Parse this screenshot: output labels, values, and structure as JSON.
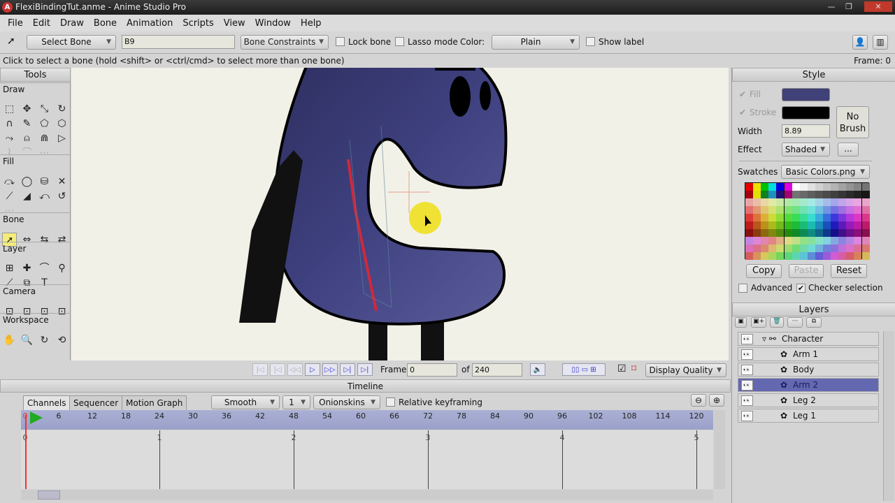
{
  "window": {
    "title": "FlexiBindingTut.anme - Anime Studio Pro",
    "logo": "A",
    "controls": [
      "—",
      "❐",
      "✕"
    ]
  },
  "menu": [
    "File",
    "Edit",
    "Draw",
    "Bone",
    "Animation",
    "Scripts",
    "View",
    "Window",
    "Help"
  ],
  "toolbar": {
    "tool_select": "Select Bone",
    "bone_name": "B9",
    "constraints": "Bone Constraints",
    "lock_bone": "Lock bone",
    "lock_bone_checked": false,
    "lasso_mode": "Lasso mode",
    "lasso_checked": false,
    "color_label": "Color:",
    "color_value": "Plain",
    "show_label": "Show label",
    "show_label_checked": false
  },
  "status": {
    "hint": "Click to select a bone (hold <shift> or <ctrl/cmd> to select more than one bone)",
    "frame": "Frame: 0"
  },
  "tools": {
    "title": "Tools",
    "sections": {
      "draw": "Draw",
      "fill": "Fill",
      "bone": "Bone",
      "layer": "Layer",
      "camera": "Camera",
      "workspace": "Workspace"
    }
  },
  "style": {
    "title": "Style",
    "fill_label": "Fill",
    "fill_color": "#3f4178",
    "stroke_label": "Stroke",
    "stroke_color": "#000000",
    "width_label": "Width",
    "width_value": "8.89",
    "no_brush": "No Brush",
    "effect_label": "Effect",
    "effect_value": "Shaded",
    "more": "...",
    "swatches_label": "Swatches",
    "swatches_value": "Basic Colors.png",
    "copy": "Copy",
    "paste": "Paste",
    "reset": "Reset",
    "advanced": "Advanced",
    "advanced_checked": false,
    "checker": "Checker selection",
    "checker_checked": true
  },
  "layers": {
    "title": "Layers",
    "items": [
      {
        "name": "Character",
        "type": "bone-group"
      },
      {
        "name": "Arm 1",
        "type": "vector"
      },
      {
        "name": "Body",
        "type": "vector"
      },
      {
        "name": "Arm 2",
        "type": "vector",
        "selected": true
      },
      {
        "name": "Leg 2",
        "type": "vector"
      },
      {
        "name": "Leg 1",
        "type": "vector"
      }
    ]
  },
  "playback": {
    "frame_label": "Frame",
    "frame_value": "0",
    "of_label": "of",
    "total": "240",
    "display_quality": "Display Quality"
  },
  "timeline": {
    "title": "Timeline",
    "tabs": [
      "Channels",
      "Sequencer",
      "Motion Graph"
    ],
    "interp": "Smooth",
    "interp_num": "1",
    "onionskins": "Onionskins",
    "relative": "Relative keyframing",
    "relative_checked": false,
    "ruler": [
      "0",
      "6",
      "12",
      "18",
      "24",
      "30",
      "36",
      "42",
      "48",
      "54",
      "60",
      "66",
      "72",
      "78",
      "84",
      "90",
      "96",
      "102",
      "108",
      "114",
      "120"
    ],
    "seconds": [
      "0",
      "1",
      "2",
      "3",
      "4",
      "5"
    ]
  },
  "colors": {
    "accent": "#6468b0",
    "body": "#3d3f7a",
    "bone": "#d0283c"
  }
}
